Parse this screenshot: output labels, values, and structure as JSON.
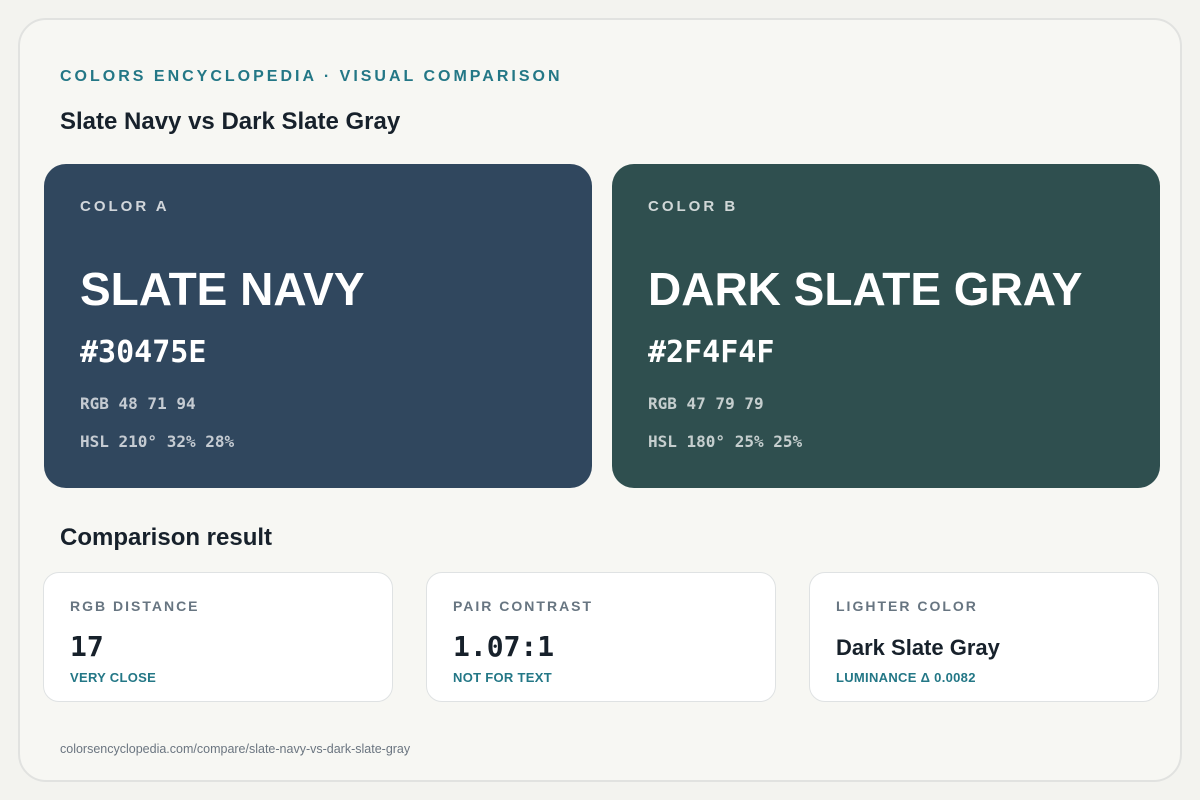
{
  "header": {
    "eyebrow": "COLORS ENCYCLOPEDIA · VISUAL COMPARISON",
    "title": "Slate Navy vs Dark Slate Gray"
  },
  "colors": {
    "a": {
      "label": "COLOR A",
      "name": "SLATE NAVY",
      "hex": "#30475E",
      "rgb": "RGB 48 71 94",
      "hsl": "HSL 210° 32% 28%",
      "swatch_color": "#30475E"
    },
    "b": {
      "label": "COLOR B",
      "name": "DARK SLATE GRAY",
      "hex": "#2F4F4F",
      "rgb": "RGB 47 79 79",
      "hsl": "HSL 180° 25% 25%",
      "swatch_color": "#2F4F4F"
    }
  },
  "comparison": {
    "title": "Comparison result",
    "stats": [
      {
        "label": "RGB DISTANCE",
        "value": "17",
        "note": "VERY CLOSE"
      },
      {
        "label": "PAIR CONTRAST",
        "value": "1.07:1",
        "note": "NOT FOR TEXT"
      },
      {
        "label": "LIGHTER COLOR",
        "value": "Dark Slate Gray",
        "note": "LUMINANCE Δ 0.0082"
      }
    ]
  },
  "footer": {
    "url": "colorsencyclopedia.com/compare/slate-navy-vs-dark-slate-gray"
  },
  "theme": {
    "accent": "#237786",
    "text": "#17212b",
    "muted": "#677581"
  }
}
